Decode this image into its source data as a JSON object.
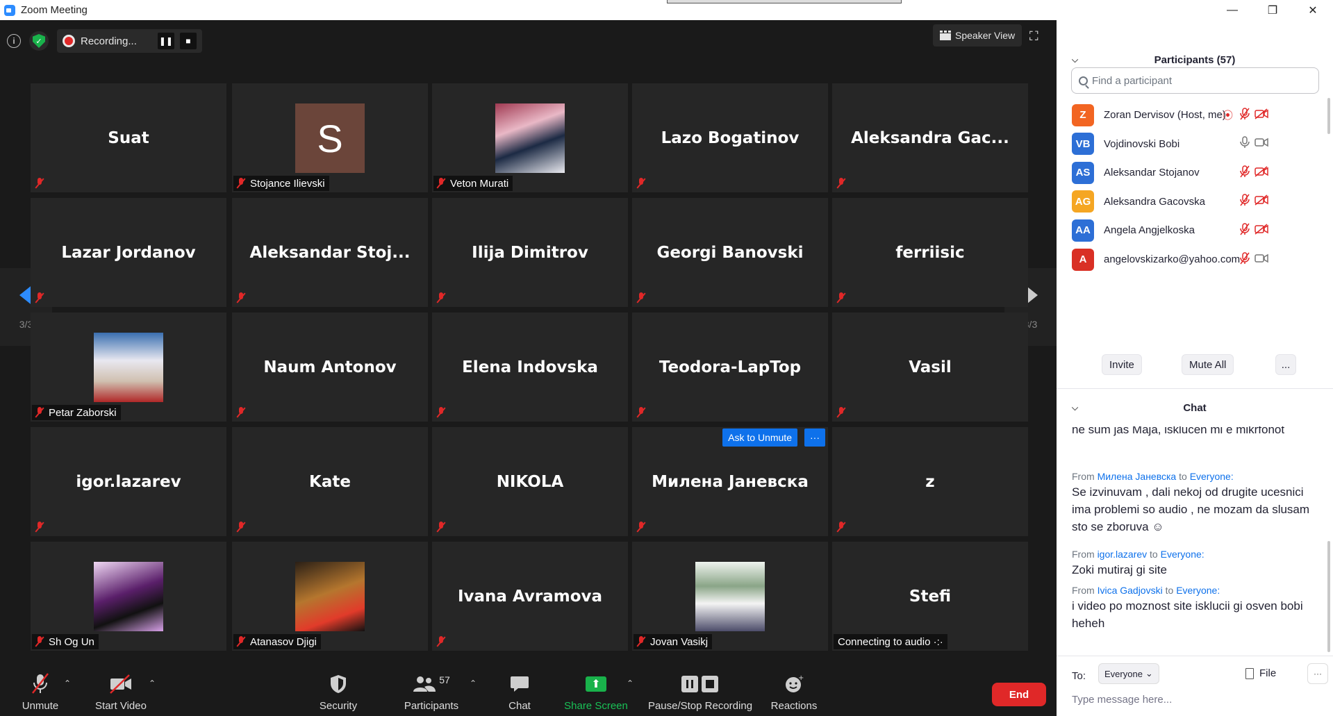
{
  "window": {
    "title": "Zoom Meeting",
    "controls": [
      "—",
      "❐",
      "✕"
    ]
  },
  "topbar": {
    "recording_label": "Recording...",
    "view_label": "Speaker View"
  },
  "tiles": [
    {
      "name": "Suat",
      "tag": "",
      "type": "name"
    },
    {
      "name": "",
      "tag": "Stojance Ilievski",
      "type": "letter",
      "letter": "S"
    },
    {
      "name": "",
      "tag": "Veton Murati",
      "type": "photo"
    },
    {
      "name": "Lazo Bogatinov",
      "tag": "",
      "type": "name"
    },
    {
      "name": "Aleksandra  Gac...",
      "tag": "",
      "type": "name"
    },
    {
      "name": "Lazar Jordanov",
      "tag": "",
      "type": "name"
    },
    {
      "name": "Aleksandar  Stoj...",
      "tag": "",
      "type": "name"
    },
    {
      "name": "Ilija Dimitrov",
      "tag": "",
      "type": "name"
    },
    {
      "name": "Georgi Banovski",
      "tag": "",
      "type": "name"
    },
    {
      "name": "ferriisic",
      "tag": "",
      "type": "name"
    },
    {
      "name": "",
      "tag": "Petar Zaborski",
      "type": "photo"
    },
    {
      "name": "Naum Antonov",
      "tag": "",
      "type": "name"
    },
    {
      "name": "Elena Indovska",
      "tag": "",
      "type": "name"
    },
    {
      "name": "Teodora-LapTop",
      "tag": "",
      "type": "name"
    },
    {
      "name": "Vasil",
      "tag": "",
      "type": "name"
    },
    {
      "name": "igor.lazarev",
      "tag": "",
      "type": "name"
    },
    {
      "name": "Kate",
      "tag": "",
      "type": "name"
    },
    {
      "name": "NIKOLA",
      "tag": "",
      "type": "name"
    },
    {
      "name": "Милена Јаневска",
      "tag": "",
      "type": "name",
      "ask_unmute": "Ask to Unmute",
      "more": "···"
    },
    {
      "name": "z",
      "tag": "",
      "type": "name"
    },
    {
      "name": "",
      "tag": "Sh Og Un",
      "type": "photo"
    },
    {
      "name": "",
      "tag": "Atanasov Djigi",
      "type": "photo"
    },
    {
      "name": "Ivana Avramova",
      "tag": "",
      "type": "name"
    },
    {
      "name": "",
      "tag": "Jovan Vasikj",
      "type": "photo"
    },
    {
      "name": "Stefi",
      "tag": "",
      "type": "name",
      "connecting": "Connecting to audio ·:·"
    }
  ],
  "pagination": {
    "left": "3/3",
    "right": "3/3"
  },
  "toolbar": {
    "unmute": "Unmute",
    "start_video": "Start Video",
    "security": "Security",
    "participants": "Participants",
    "participants_count": "57",
    "chat": "Chat",
    "share_screen": "Share Screen",
    "pause_stop_recording": "Pause/Stop Recording",
    "reactions": "Reactions",
    "end": "End"
  },
  "participants_panel": {
    "title": "Participants (57)",
    "search_placeholder": "Find a participant",
    "list": [
      {
        "initials": "Z",
        "name": "Zoran Dervisov (Host, me)",
        "color": "#f26522",
        "mic": "muted",
        "video": "off",
        "recording": true
      },
      {
        "initials": "VB",
        "name": "Vojdinovski Bobi",
        "color": "#2d6fd6",
        "mic": "on",
        "video": "on"
      },
      {
        "initials": "AS",
        "name": "Aleksandar Stojanov",
        "color": "#2d6fd6",
        "mic": "muted",
        "video": "off"
      },
      {
        "initials": "AG",
        "name": "Aleksandra Gacovska",
        "color": "#f5a623",
        "mic": "muted",
        "video": "off"
      },
      {
        "initials": "AA",
        "name": "Angela Angjelkoska",
        "color": "#2d6fd6",
        "mic": "muted",
        "video": "off"
      },
      {
        "initials": "A",
        "name": "angelovskizarko@yahoo.com",
        "color": "#d93025",
        "mic": "muted",
        "video": "on"
      }
    ],
    "buttons": {
      "invite": "Invite",
      "mute_all": "Mute All",
      "more": "..."
    }
  },
  "chat_panel": {
    "title": "Chat",
    "messages": [
      {
        "from": "",
        "to": "",
        "text": "ne sum jas Maja, isklucen mi e mikrfonot"
      },
      {
        "from": "Милена Јаневска",
        "to": "Everyone:",
        "text": "Se izvinuvam , dali nekoj od drugite ucesnici  ima problemi so audio , ne mozam da slusam sto se zboruva ☺"
      },
      {
        "from": "igor.lazarev",
        "to": "Everyone:",
        "text": "Zoki mutiraj gi site"
      },
      {
        "from": "Ivica Gadjovski",
        "to": "Everyone:",
        "text": "i video po moznost site isklucii gi osven bobi heheh"
      }
    ],
    "from_label": "From",
    "to_label": "to",
    "footer": {
      "to": "To:",
      "recipient": "Everyone",
      "file": "File",
      "more": "···",
      "placeholder": "Type message here..."
    }
  }
}
